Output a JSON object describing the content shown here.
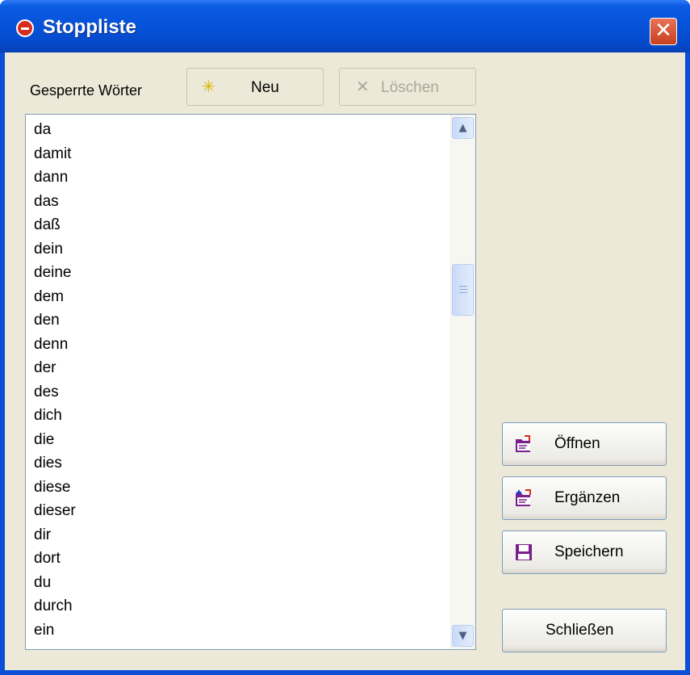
{
  "window": {
    "title": "Stoppliste",
    "close_symbol": "✕",
    "title_icon": "stop-sign-icon"
  },
  "label": "Gesperrte Wörter",
  "toolbar": {
    "neu_label": "Neu",
    "neu_icon": "sparkle-icon",
    "loeschen_label": "Löschen",
    "loeschen_icon": "x-icon",
    "loeschen_enabled": false
  },
  "words": [
    "da",
    "damit",
    "dann",
    "das",
    "daß",
    "dein",
    "deine",
    "dem",
    "den",
    "denn",
    "der",
    "des",
    "dich",
    "die",
    "dies",
    "diese",
    "dieser",
    "dir",
    "dort",
    "du",
    "durch",
    "ein"
  ],
  "actions": {
    "oeffnen_label": "Öffnen",
    "ergaenzen_label": "Ergänzen",
    "speichern_label": "Speichern",
    "schliessen_label": "Schließen"
  },
  "colors": {
    "titlebar": "#0652d8",
    "face": "#ece9d8",
    "border": "#7f9db9",
    "icon_purple": "#7a1f8c"
  }
}
